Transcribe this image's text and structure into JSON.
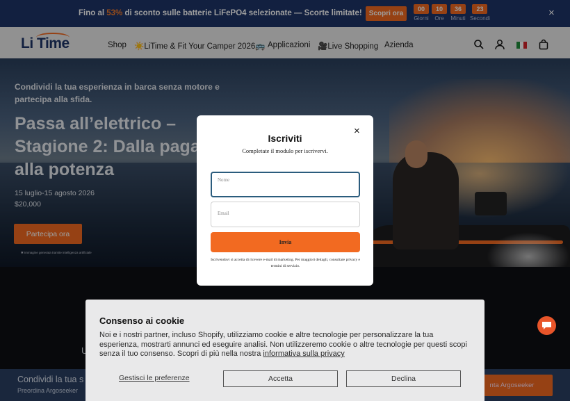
{
  "promo": {
    "text_before": "Fino al ",
    "percent": "53%",
    "text_after": " di sconto sulle batterie LiFePO4 selezionate — Scorte limitate!",
    "cta": "Scopri ora",
    "countdown": [
      {
        "value": "00",
        "label": "Giorni"
      },
      {
        "value": "10",
        "label": "Ore"
      },
      {
        "value": "36",
        "label": "Minuti"
      },
      {
        "value": "23",
        "label": "Secondi"
      }
    ],
    "close": "×"
  },
  "header": {
    "logo": "Li Time",
    "nav": [
      "Shop",
      "☀️LiTime & Fit Your Camper 2026🚌",
      "Applicazioni",
      "🎥Live Shopping",
      "Azienda"
    ]
  },
  "hero": {
    "subtitle": "Condividi la tua esperienza in barca senza motore e partecipa alla sfida.",
    "title": "Passa all’elettrico – Stagione 2: Dalla pagaia alla potenza",
    "dates": "15 luglio-15 agosto 2026",
    "prize": "$20,000",
    "cta": "Partecipa ora",
    "note": "✱ Immagine generata tramite intelligenza artificiale"
  },
  "modal": {
    "title": "Iscriviti",
    "subtitle": "Completate il modulo per iscrivervi.",
    "name_label": "Nome",
    "email_label": "Email",
    "submit": "Invia",
    "legal": "Iscrivendovi si accetta di ricevere e-mail di marketing. Per maggiori dettagli, consultare privacy e termini di servizio.",
    "close": "×"
  },
  "below": {
    "letter": "U",
    "sticky_title": "Condividi la tua s",
    "sticky_sub": "Preordina Argoseeker",
    "sticky_cta": "nta Argoseeker"
  },
  "cookie": {
    "title": "Consenso ai cookie",
    "text": "Noi e i nostri partner, incluso Shopify, utilizziamo cookie e altre tecnologie per personalizzare la tua esperienza, mostrarti annunci ed eseguire analisi. Non utilizzeremo cookie o altre tecnologie per questi scopi senza il tuo consenso. Scopri di più nella nostra ",
    "link": "informativa sulla privacy",
    "manage": "Gestisci le preferenze",
    "accept": "Accetta",
    "decline": "Declina"
  },
  "colors": {
    "accent": "#f26a21",
    "navy": "#1d3468"
  }
}
